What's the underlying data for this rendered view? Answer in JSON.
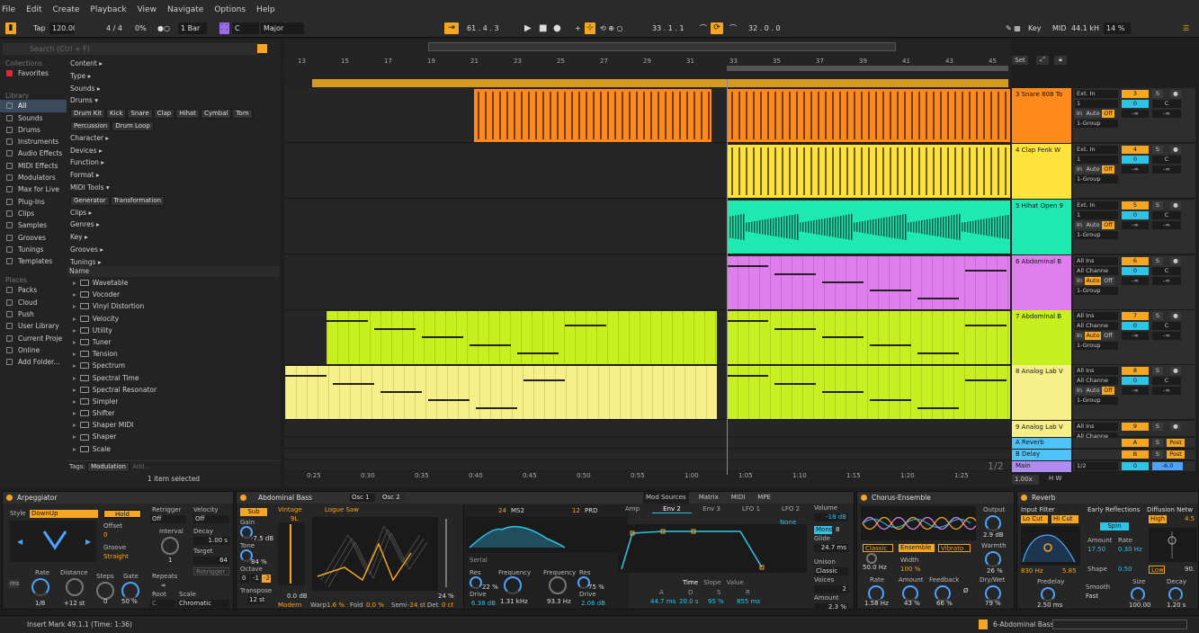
{
  "menu": [
    "File",
    "Edit",
    "Create",
    "Playback",
    "View",
    "Navigate",
    "Options",
    "Help"
  ],
  "transport": {
    "tap": "Tap",
    "tempo": "120.00",
    "sig": "4 / 4",
    "groove": "0%",
    "quant": "1 Bar",
    "key": "C",
    "scale": "Major",
    "position": "61 .  4 .  3",
    "loop_start": "33 .  1 .  1",
    "loop_len": "32 .  0 .  0",
    "key_btn": "Key",
    "midi_btn": "MIDI",
    "sample_rate": "44.1 kHz",
    "cpu": "14 %"
  },
  "browser": {
    "search_placeholder": "Search (Ctrl + F)",
    "collections_label": "Collections",
    "favorites": "Favorites",
    "library_label": "Library",
    "library": [
      "All",
      "Sounds",
      "Drums",
      "Instruments",
      "Audio Effects",
      "MIDI Effects",
      "Modulators",
      "Max for Live",
      "Plug-Ins",
      "Clips",
      "Samples",
      "Grooves",
      "Tunings",
      "Templates"
    ],
    "places_label": "Places",
    "places": [
      "Packs",
      "Cloud",
      "Push",
      "User Library",
      "Current Proje",
      "Online",
      "Add Folder..."
    ],
    "filters": [
      "Content ▸",
      "Type ▸",
      "Sounds ▸",
      "Drums ▾"
    ],
    "drum_chips": [
      "Drum Kit",
      "Kick",
      "Snare",
      "Clap",
      "Hihat",
      "Cymbal",
      "Tom"
    ],
    "drum_chips2": [
      "Percussion",
      "Drum Loop"
    ],
    "filters2": [
      "Character ▸",
      "Devices ▸",
      "Function ▸",
      "Format ▸",
      "MIDI Tools ▾"
    ],
    "midi_chips": [
      "Generator",
      "Transformation"
    ],
    "filters3": [
      "Clips ▸",
      "Genres ▸",
      "Key ▸",
      "Grooves ▸",
      "Tunings ▸"
    ],
    "name_header": "Name",
    "items": [
      "Wavetable",
      "Vocoder",
      "Vinyl Distortion",
      "Velocity",
      "Utility",
      "Tuner",
      "Tension",
      "Spectrum",
      "Spectral Time",
      "Spectral Resonator",
      "Simpler",
      "Shifter",
      "Shaper MIDI",
      "Shaper",
      "Scale"
    ],
    "tags_label": "Tags:",
    "tag_value": "Modulation",
    "tag_add": "Add...",
    "selected_count": "1 item selected"
  },
  "ruler": [
    "13",
    "15",
    "17",
    "19",
    "21",
    "23",
    "25",
    "27",
    "29",
    "31",
    "33",
    "35",
    "37",
    "39",
    "41",
    "43",
    "45"
  ],
  "timeline": [
    "0:25",
    "0:30",
    "0:35",
    "0:40",
    "0:45",
    "0:50",
    "0:55",
    "1:00",
    "1:05",
    "1:10",
    "1:15",
    "1:20",
    "1:25"
  ],
  "page": "1/2",
  "zoom": "1.00x",
  "set": "Set",
  "colors": {
    "orange": "#f0a030",
    "snare": "#ff8a1c",
    "clap": "#ffe33a",
    "hihat": "#1de9b0",
    "abdominal": "#e07ef0",
    "abdominal7": "#c8f020",
    "analog": "#f7f08a",
    "return": "#4fc3f7"
  },
  "tracks": [
    {
      "name": "3 Snare 808 To",
      "input": "Ext. In",
      "ch": "1",
      "mon": "Off",
      "out": "1-Group",
      "num": "3",
      "vol": "0",
      "pan": "C"
    },
    {
      "name": "4 Clap Fenk W",
      "input": "Ext. In",
      "ch": "1",
      "mon": "Off",
      "out": "1-Group",
      "num": "4",
      "vol": "0",
      "pan": "C"
    },
    {
      "name": "5 Hihat Open 9",
      "input": "Ext. In",
      "ch": "1",
      "mon": "Off",
      "out": "1-Group",
      "num": "5",
      "vol": "0",
      "pan": "C"
    },
    {
      "name": "6 Abdominal B",
      "input": "All Ins",
      "ch": "All Channe",
      "mon": "Off",
      "out": "1-Group",
      "num": "6",
      "vol": "0",
      "pan": "C"
    },
    {
      "name": "7 Abdominal B",
      "input": "All Ins",
      "ch": "All Channe",
      "mon": "Off",
      "out": "1-Group",
      "num": "7",
      "vol": "0",
      "pan": "C"
    },
    {
      "name": "8 Analog Lab V",
      "input": "All Ins",
      "ch": "All Channe",
      "mon": "Off",
      "out": "1-Group",
      "num": "8",
      "vol": "0",
      "pan": "C"
    },
    {
      "name": "9 Analog Lab V",
      "input": "All Ins",
      "ch": "All Channe",
      "num": "9"
    }
  ],
  "returns": [
    {
      "name": "A Reverb",
      "letter": "A",
      "post": "Post"
    },
    {
      "name": "B Delay",
      "letter": "B",
      "post": "Post"
    },
    {
      "name": "Main",
      "page": "1/2",
      "num": "0",
      "vol": "-6.0"
    }
  ],
  "mon_labels": {
    "in": "In",
    "auto": "Auto",
    "inf": "-∞"
  },
  "arp": {
    "title": "Arpeggiator",
    "style_label": "Style",
    "style": "DownUp",
    "hold": "Hold",
    "offset_label": "Offset",
    "offset": "0",
    "groove_label": "Groove",
    "groove": "Straight",
    "retrig_label": "Retrigger",
    "retrig": "Off",
    "interval_label": "Interval",
    "interval": "1",
    "repeats_label": "Repeats",
    "repeats": "∞",
    "vel_label": "Velocity",
    "vel": "Off",
    "decay_label": "Decay",
    "decay": "1.00 s",
    "target_label": "Target",
    "target": "64",
    "retrig_btn": "Retrigger",
    "rate_label": "Rate",
    "rate": "1/8",
    "dist_label": "Distance",
    "dist": "+12 st",
    "steps_label": "Steps",
    "steps": "0",
    "gate_label": "Gate",
    "gate": "50 %",
    "root_label": "Root",
    "root": "C",
    "scale_label": "Scale",
    "scale": "Chromatic",
    "ms": "ms"
  },
  "synth": {
    "title": "Abdominal Bass",
    "osc1": "Osc 1",
    "osc2": "Osc 2",
    "sub": "Sub",
    "gain_label": "Gain",
    "gain": "-7.5 dB",
    "tone_label": "Tone",
    "tone": "84 %",
    "oct_label": "Octave",
    "oct": [
      "0",
      "-1",
      "-2"
    ],
    "transpose_label": "Transpose",
    "transpose": "12 st",
    "wt_cat": "Vintage",
    "wt_name": "Logue Saw",
    "wt_idx": "9L",
    "level": "0.0 dB",
    "pct": "24 %",
    "mode": "Modern",
    "warp_label": "Warp",
    "warp": "1.6 %",
    "fold_label": "Fold",
    "fold": "0.0 %",
    "semi_label": "Semi",
    "semi": "-24 st",
    "det_label": "Det",
    "det": "0 ct",
    "f1_slope": "24",
    "f1_type": "MS2",
    "f2_slope": "12",
    "f2_type": "PRD",
    "serial": "Serial",
    "res1_label": "Res",
    "res1": "22 %",
    "freq1_label": "Frequency",
    "freq1": "1.31 kHz",
    "drive1_label": "Drive",
    "drive1": "6.38 dB",
    "freq2_label": "Frequency",
    "freq2": "93.3 Hz",
    "res2_label": "Res",
    "res2": "75 %",
    "drive2_label": "Drive",
    "drive2": "2.06 dB",
    "mod_tabs": [
      "Mod Sources",
      "Matrix",
      "MIDI",
      "MPE"
    ],
    "env_tabs": [
      "Amp",
      "Env 2",
      "Env 3",
      "LFO 1",
      "LFO 2"
    ],
    "none": "None",
    "env_views": [
      "Time",
      "Slope",
      "Value"
    ],
    "adsr_labels": [
      "A",
      "D",
      "S",
      "R"
    ],
    "adsr": [
      "44.7 ms",
      "20.0 s",
      "95 %",
      "855 ms"
    ],
    "vol_label": "Volume",
    "vol": "-18 dB",
    "mono": "Mono",
    "voices_n": "8",
    "glide_label": "Glide",
    "glide": "24.7 ms",
    "unison_label": "Unison",
    "unison": "Classic",
    "voices_label": "Voices",
    "voices": "2",
    "amount_label": "Amount",
    "amount": "2.3 %"
  },
  "chorus": {
    "title": "Chorus-Ensemble",
    "modes": [
      "Classic",
      "Ensemble",
      "Vibrato"
    ],
    "hz": "50.0 Hz",
    "width_label": "Width",
    "width": "100 %",
    "output_label": "Output",
    "output": "2.9 dB",
    "warmth_label": "Warmth",
    "warmth": "26 %",
    "rate_label": "Rate",
    "rate": "1.58 Hz",
    "amount_label": "Amount",
    "amount": "43 %",
    "fb_label": "Feedback",
    "fb": "66 %",
    "phase": "Ø",
    "drywet_label": "Dry/Wet",
    "drywet": "79 %"
  },
  "reverb": {
    "title": "Reverb",
    "input_label": "Input Filter",
    "locut": "Lo Cut",
    "hicut": "Hi Cut",
    "freq": "830 Hz",
    "q": "5.85",
    "early_label": "Early Reflections",
    "spin": "Spin",
    "amount_label": "Amount",
    "amount": "17.50",
    "rate_label": "Rate",
    "rate": "0.30 Hz",
    "shape_label": "Shape",
    "shape": "0.50",
    "diff_label": "Diffusion Netw",
    "high": "High",
    "high_val": "4.5",
    "low": "Low",
    "low_val": "90.",
    "predelay_label": "Predelay",
    "predelay": "2.50 ms",
    "smooth_label": "Smooth",
    "smooth": "Fast",
    "size_label": "Size",
    "size": "100.00",
    "decay_label": "Decay",
    "decay": "1.20 s"
  },
  "status": {
    "msg": "Insert Mark 49.1.1 (Time: 1:36)",
    "track": "6-Abdominal Bass"
  }
}
